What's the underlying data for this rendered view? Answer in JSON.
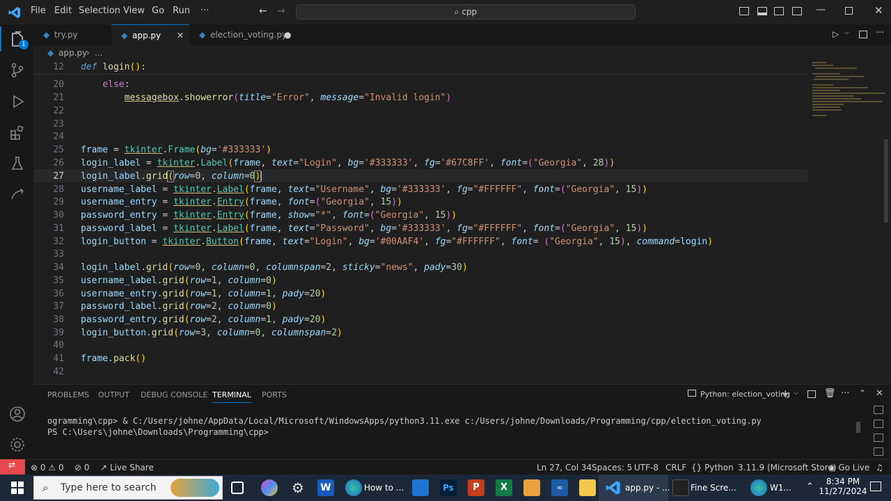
{
  "menu": [
    "File",
    "Edit",
    "Selection",
    "View",
    "Go",
    "Run",
    "···"
  ],
  "search": "cpp",
  "tabs": [
    {
      "label": "try.py"
    },
    {
      "label": "app.py"
    },
    {
      "label": "election_voting.py"
    }
  ],
  "breadcrumb": {
    "file": "app.py",
    "more": "..."
  },
  "badge": "1",
  "code_lines": [
    {
      "n": "12"
    },
    {
      "n": "20"
    },
    {
      "n": "21"
    },
    {
      "n": "22"
    },
    {
      "n": "23"
    },
    {
      "n": "24"
    },
    {
      "n": "25"
    },
    {
      "n": "26"
    },
    {
      "n": "27"
    },
    {
      "n": "28"
    },
    {
      "n": "29"
    },
    {
      "n": "30"
    },
    {
      "n": "31"
    },
    {
      "n": "32"
    },
    {
      "n": "33"
    },
    {
      "n": "34"
    },
    {
      "n": "35"
    },
    {
      "n": "36"
    },
    {
      "n": "37"
    },
    {
      "n": "38"
    },
    {
      "n": "39"
    },
    {
      "n": "40"
    },
    {
      "n": "41"
    },
    {
      "n": "42"
    }
  ],
  "panel": {
    "tabs": [
      "PROBLEMS",
      "OUTPUT",
      "DEBUG CONSOLE",
      "TERMINAL",
      "PORTS"
    ],
    "terminal_name": "Python: election_voting",
    "lines": [
      "ogramming\\cpp> & C:/Users/johne/AppData/Local/Microsoft/WindowsApps/python3.11.exe c:/Users/johne/Downloads/Programming/cpp/election_voting.py",
      "PS C:\\Users\\johne\\Downloads\\Programming\\cpp> "
    ]
  },
  "status": {
    "errors": "0",
    "warnings": "0",
    "ports": "0",
    "liveshare": "Live Share",
    "position": "Ln 27, Col 34",
    "spaces": "Spaces: 5",
    "encoding": "UTF-8",
    "eol": "CRLF",
    "lang": "Python",
    "interpreter": "3.11.9 (Microsoft Store)",
    "golive": "Go Live"
  },
  "taskbar": {
    "search_placeholder": "Type here to search",
    "edge_label": "How to ...",
    "vscode_label": "app.py - ...",
    "fine_label": "Fine Scre...",
    "w1_label": "W1...",
    "time": "8:34 PM",
    "date": "11/27/2024"
  },
  "colors": {
    "accent": "#0078d4",
    "remote": "#e5484d",
    "editor_bg": "#1f1f1f"
  }
}
